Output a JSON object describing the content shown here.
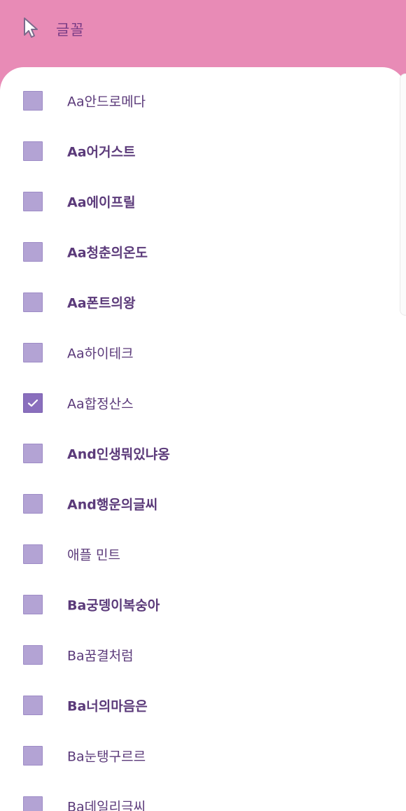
{
  "header": {
    "title": "글꼴",
    "icon": "cursor-arrow-icon",
    "background_color": "#e88bb6"
  },
  "font_list": {
    "checkbox_color": "#b3a3d4",
    "checked_color": "#8a6fbd",
    "items": [
      {
        "label": "Aa안드로메다",
        "checked": false,
        "bold": false
      },
      {
        "label": "Aa어거스트",
        "checked": false,
        "bold": true
      },
      {
        "label": "Aa에이프릴",
        "checked": false,
        "bold": true
      },
      {
        "label": "Aa청춘의온도",
        "checked": false,
        "bold": true
      },
      {
        "label": "Aa폰트의왕",
        "checked": false,
        "bold": true
      },
      {
        "label": "Aa하이테크",
        "checked": false,
        "bold": false
      },
      {
        "label": "Aa합정산스",
        "checked": true,
        "bold": false
      },
      {
        "label": "And인생뭐있냐옹",
        "checked": false,
        "bold": true
      },
      {
        "label": "And행운의글씨",
        "checked": false,
        "bold": true
      },
      {
        "label": "애플 민트",
        "checked": false,
        "bold": false
      },
      {
        "label": "Ba궁뎅이복숭아",
        "checked": false,
        "bold": true
      },
      {
        "label": "Ba꿈결처럼",
        "checked": false,
        "bold": false
      },
      {
        "label": "Ba너의마음은",
        "checked": false,
        "bold": true
      },
      {
        "label": "Ba눈탱구르르",
        "checked": false,
        "bold": false
      },
      {
        "label": "Ba데일리극씨",
        "checked": false,
        "bold": false
      }
    ]
  }
}
